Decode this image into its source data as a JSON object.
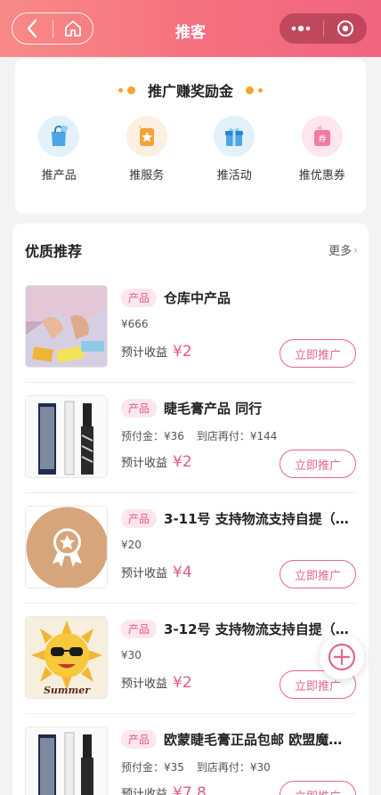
{
  "header": {
    "title": "推客",
    "back_icon": "chevron-left-icon",
    "home_icon": "home-icon",
    "more_icon": "more-dots-icon",
    "close_icon": "target-icon"
  },
  "reward": {
    "title": "推广赚奖励金",
    "categories": [
      {
        "label": "推产品",
        "icon": "shopping-bag-icon"
      },
      {
        "label": "推服务",
        "icon": "star-badge-icon"
      },
      {
        "label": "推活动",
        "icon": "gift-icon"
      },
      {
        "label": "推优惠券",
        "icon": "coupon-icon",
        "icon_text": "券"
      }
    ]
  },
  "recommend": {
    "title": "优质推荐",
    "more_label": "更多",
    "earn_label": "预计收益",
    "button_label": "立即推广",
    "items": [
      {
        "tag": "产品",
        "name": "仓库中产品",
        "price": "¥666",
        "earn": "¥2"
      },
      {
        "tag": "产品",
        "name": "睫毛膏产品 同行",
        "price": "预付金：¥36",
        "price2": "到店再付：¥144",
        "earn": "¥2"
      },
      {
        "tag": "产品",
        "name": "3-11号 支持物流支持自提（…",
        "price": "¥20",
        "earn": "¥4"
      },
      {
        "tag": "产品",
        "name": "3-12号 支持物流支持自提（…",
        "price": "¥30",
        "earn": "¥2",
        "thumb_text": "Summer"
      },
      {
        "tag": "产品",
        "name": "欧蒙睫毛膏正品包邮 欧盟魔…",
        "price": "预付金：¥35",
        "price2": "到店再付：¥30",
        "earn": "¥7.8"
      }
    ]
  },
  "fab_icon": "plus-circle-icon",
  "colors": {
    "accent": "#e05a86",
    "header_start": "#f98a86",
    "header_end": "#f0657f",
    "dot": "#f3a531"
  }
}
